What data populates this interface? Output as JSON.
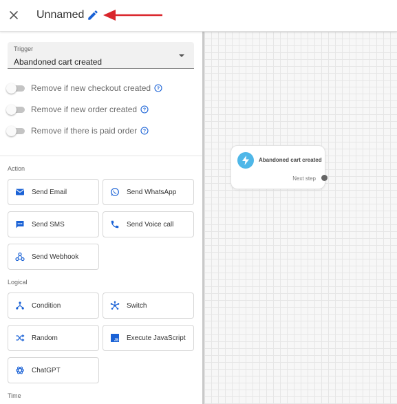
{
  "header": {
    "title": "Unnamed"
  },
  "trigger": {
    "label": "Trigger",
    "value": "Abandoned cart created"
  },
  "toggles": [
    {
      "label": "Remove if new checkout created",
      "enabled": false
    },
    {
      "label": "Remove if new order created",
      "enabled": false
    },
    {
      "label": "Remove if there is paid order",
      "enabled": false
    }
  ],
  "sections": {
    "action": "Action",
    "logical": "Logical",
    "time": "Time"
  },
  "actions": [
    {
      "label": "Send Email",
      "icon": "email-icon"
    },
    {
      "label": "Send WhatsApp",
      "icon": "whatsapp-icon"
    },
    {
      "label": "Send SMS",
      "icon": "sms-icon"
    },
    {
      "label": "Send Voice call",
      "icon": "phone-icon"
    },
    {
      "label": "Send Webhook",
      "icon": "webhook-icon"
    }
  ],
  "logical": [
    {
      "label": "Condition",
      "icon": "condition-icon"
    },
    {
      "label": "Switch",
      "icon": "switch-icon"
    },
    {
      "label": "Random",
      "icon": "shuffle-icon"
    },
    {
      "label": "Execute JavaScript",
      "icon": "javascript-icon"
    },
    {
      "label": "ChatGPT",
      "icon": "chatgpt-icon"
    }
  ],
  "canvas": {
    "node": {
      "title": "Abandoned cart created",
      "next": "Next step",
      "icon": "lightning-icon"
    }
  },
  "colors": {
    "accent": "#1a62d6",
    "annotation_arrow": "#d9262c",
    "node_icon_bg": "#4fb7e8"
  }
}
